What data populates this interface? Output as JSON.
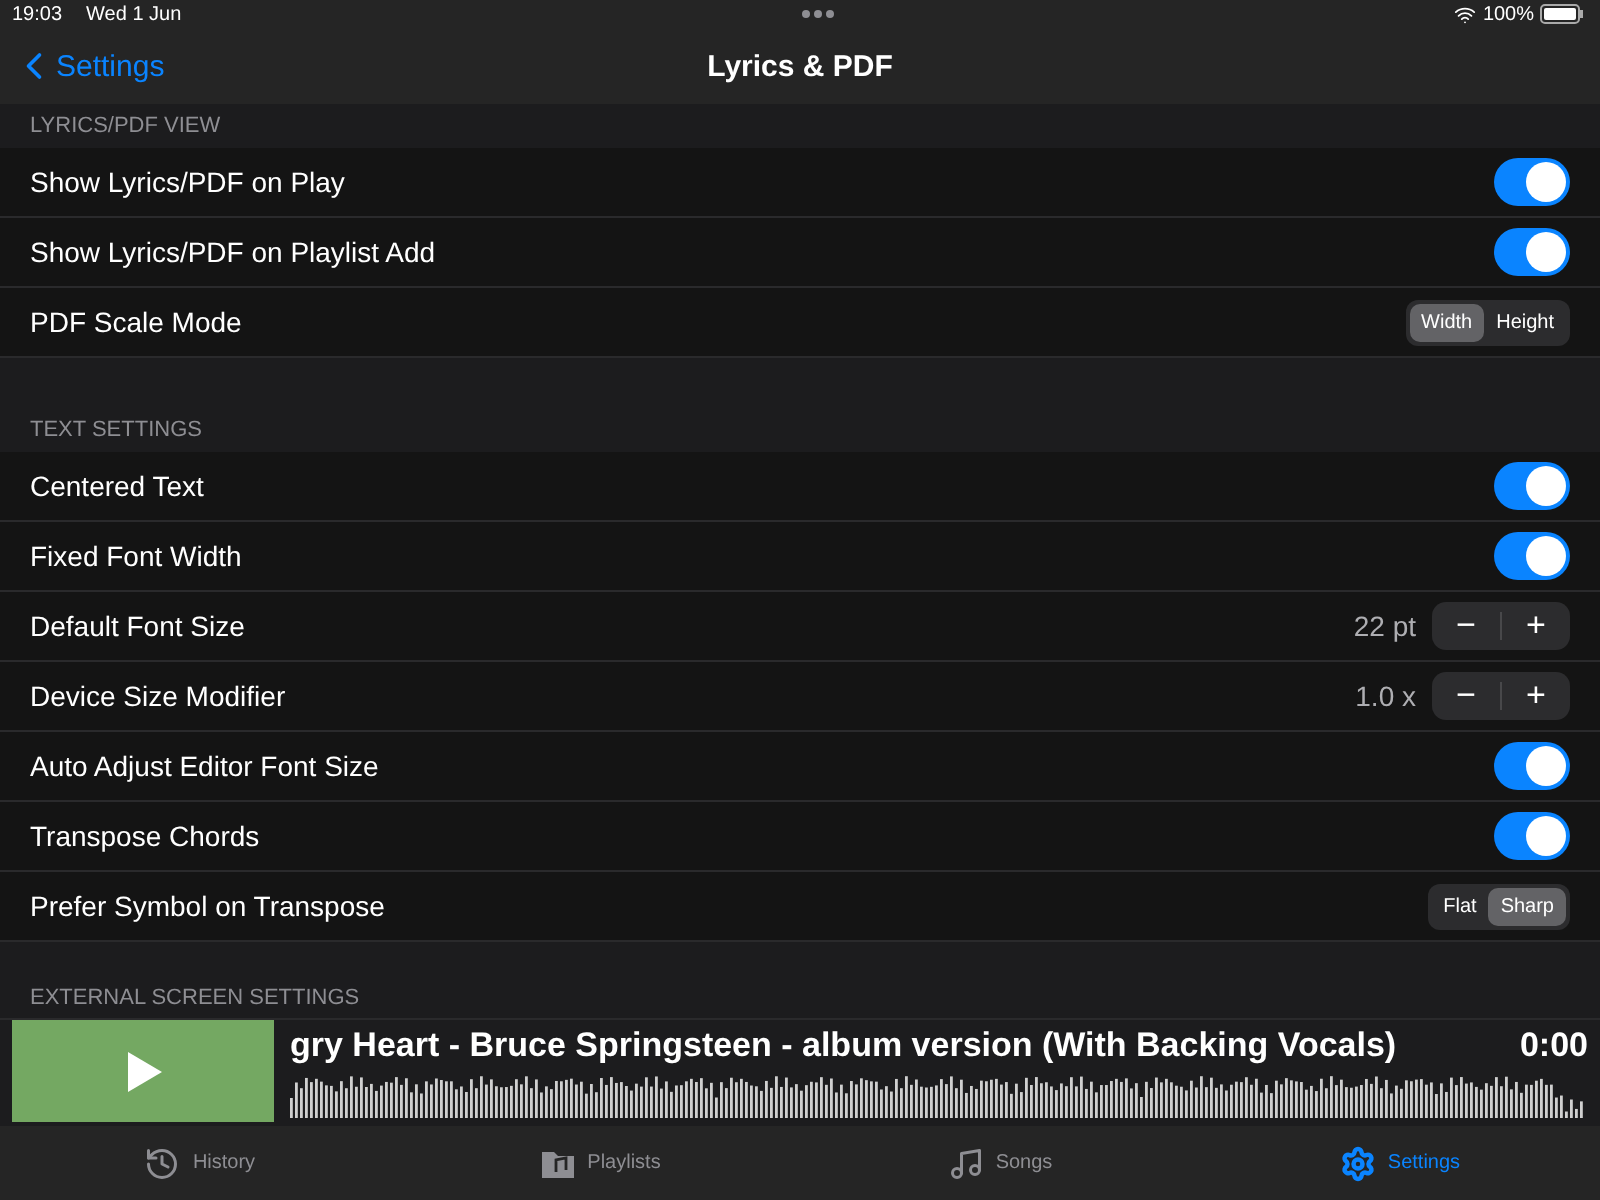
{
  "status_bar": {
    "time": "19:03",
    "date": "Wed 1 Jun",
    "battery": "100%"
  },
  "nav": {
    "back": "Settings",
    "title": "Lyrics & PDF"
  },
  "sections": [
    {
      "title": "LYRICS/PDF VIEW",
      "rows": [
        {
          "kind": "toggle",
          "label": "Show Lyrics/PDF on Play",
          "on": true
        },
        {
          "kind": "toggle",
          "label": "Show Lyrics/PDF on Playlist Add",
          "on": true
        },
        {
          "kind": "segment",
          "label": "PDF Scale Mode",
          "options": [
            {
              "label": "Width",
              "selected": true
            },
            {
              "label": "Height",
              "selected": false
            }
          ]
        }
      ]
    },
    {
      "title": "TEXT SETTINGS",
      "rows": [
        {
          "kind": "toggle",
          "label": "Centered Text",
          "on": true
        },
        {
          "kind": "toggle",
          "label": "Fixed Font Width",
          "on": true
        },
        {
          "kind": "stepper",
          "label": "Default Font Size",
          "value": "22 pt",
          "minus": "−",
          "plus": "+"
        },
        {
          "kind": "stepper",
          "label": "Device Size Modifier",
          "value": "1.0 x",
          "minus": "−",
          "plus": "+"
        },
        {
          "kind": "toggle",
          "label": "Auto Adjust Editor Font Size",
          "on": true
        },
        {
          "kind": "toggle",
          "label": "Transpose Chords",
          "on": true
        },
        {
          "kind": "segment",
          "label": "Prefer Symbol on Transpose",
          "options": [
            {
              "label": "Flat",
              "selected": false
            },
            {
              "label": "Sharp",
              "selected": true
            }
          ]
        }
      ]
    },
    {
      "title": "EXTERNAL SCREEN SETTINGS"
    }
  ],
  "player": {
    "title": "gry Heart - Bruce Springsteen - album version (With Backing Vocals)",
    "time": "0:00"
  },
  "tabs": [
    {
      "label": "History",
      "kind": "history",
      "selected": false
    },
    {
      "label": "Playlists",
      "kind": "playlists",
      "selected": false
    },
    {
      "label": "Songs",
      "kind": "songs",
      "selected": false
    },
    {
      "label": "Settings",
      "kind": "settings",
      "selected": true
    }
  ]
}
